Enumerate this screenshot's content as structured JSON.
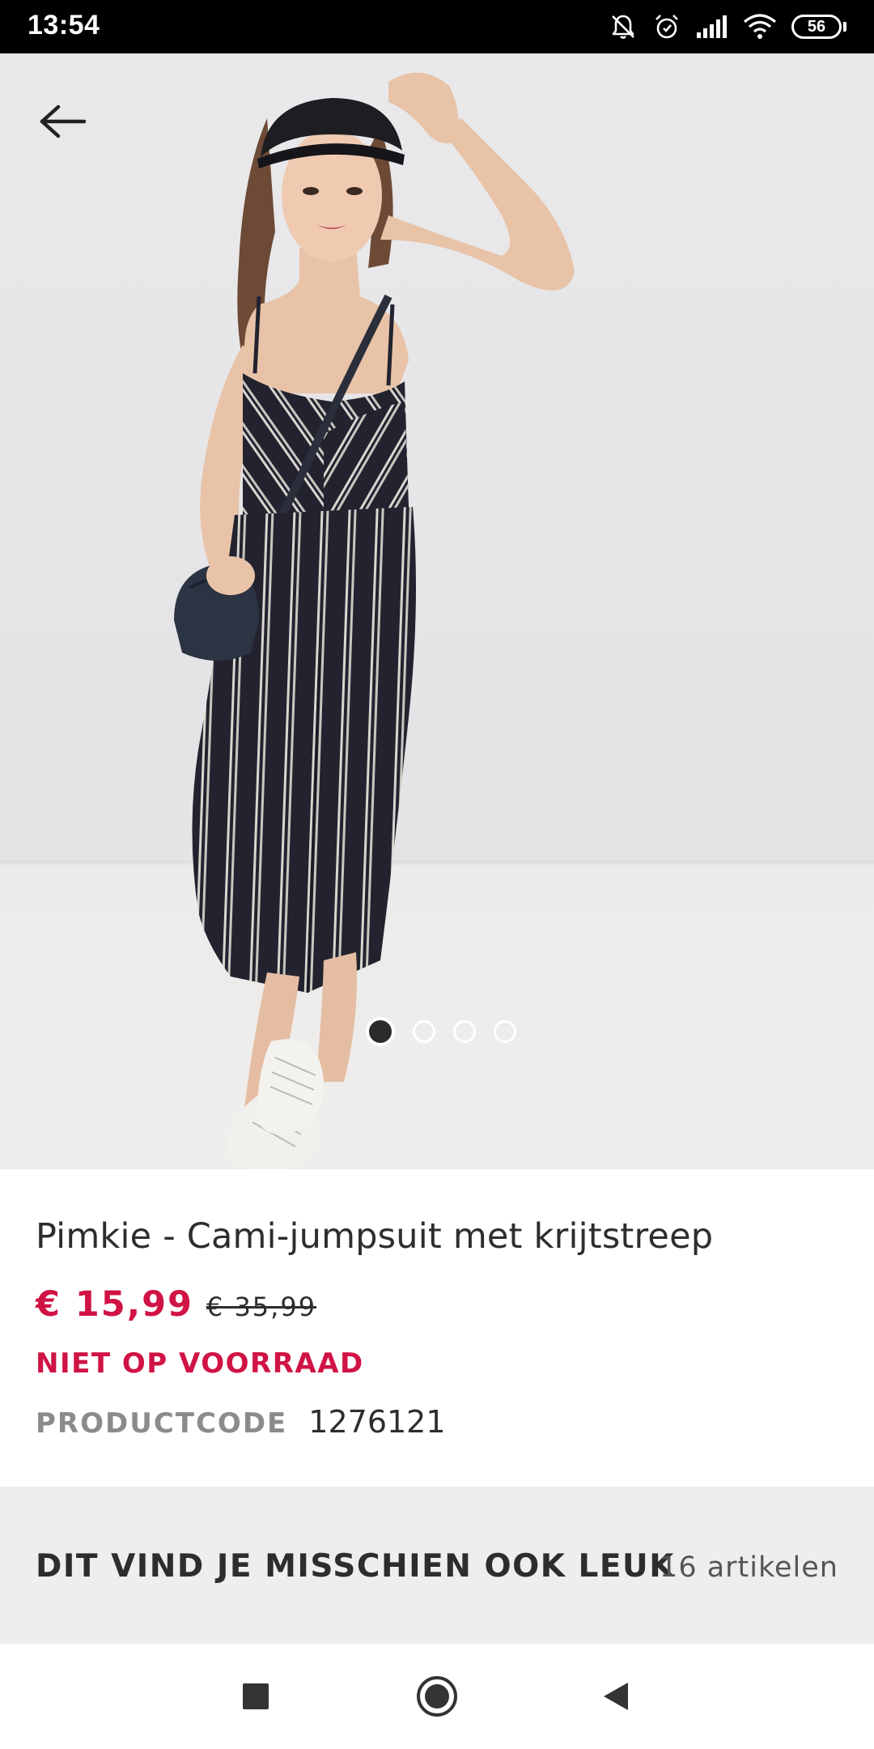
{
  "status_bar": {
    "time": "13:54",
    "battery_level": "56",
    "icons": [
      "notifications-muted-icon",
      "alarm-icon",
      "signal-icon",
      "wifi-icon",
      "battery-icon"
    ]
  },
  "gallery": {
    "image_description_icon": "product-photo",
    "slides_total": 4,
    "active_slide": 1
  },
  "product": {
    "title": "Pimkie - Cami-jumpsuit met krijtstreep",
    "price_current": "€ 15,99",
    "price_old": "€ 35,99",
    "stock_status": "NIET OP VOORRAAD",
    "code_label": "PRODUCTCODE",
    "code_value": "1276121"
  },
  "recommendations": {
    "title": "DIT VIND JE MISSCHIEN OOK LEUK",
    "count": "16 artikelen"
  },
  "colors": {
    "accent": "#d01345",
    "status_bar": "#000000",
    "section_bg": "#eeeeee",
    "text_dark": "#2d2d2d",
    "text_muted": "#8b8b8b"
  }
}
